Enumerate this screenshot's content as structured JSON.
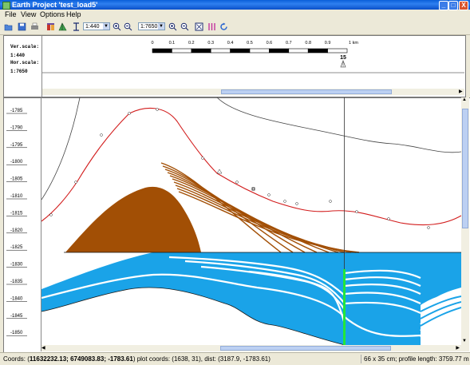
{
  "window": {
    "title": "Earth Project 'test_load5'",
    "min_label": "_",
    "max_label": "□",
    "close_label": "X"
  },
  "menu": [
    {
      "label": "File"
    },
    {
      "label": "View"
    },
    {
      "label": "Options"
    },
    {
      "label": "Help"
    }
  ],
  "toolbar": {
    "ver_zoom": "1:440",
    "hor_zoom": "1:7650"
  },
  "scale_info": {
    "ver_label": "Ver.scale:",
    "ver_value": "1:440",
    "hor_label": "Hor.scale:",
    "hor_value": "1:7650"
  },
  "ruler": {
    "ticks": [
      "0",
      "0.1",
      "0.2",
      "0.3",
      "0.4",
      "0.5",
      "0.6",
      "0.7",
      "0.8",
      "0.9",
      "1 km"
    ],
    "marker_label": "15"
  },
  "depth_axis": {
    "labels": [
      "-1785",
      "-1790",
      "-1795",
      "-1800",
      "-1805",
      "-1810",
      "-1815",
      "-1820",
      "-1825",
      "-1830",
      "-1835",
      "-1840",
      "-1845",
      "-1850"
    ]
  },
  "status": {
    "coords_prefix": "Coords: (",
    "coords_value": "11632232.13; 6749083.83; -1783.61",
    "coords_suffix": ") plot coords: (1638, 31), dist: (3187.9, -1783.61)",
    "right_text": "66 x 35 cm; profile length: 3759.77 m"
  },
  "colors": {
    "titlebar": "#0a5fd8",
    "brown": "#a24f05",
    "blue": "#1aa3e8",
    "red": "#d21c1c",
    "green": "#22e63a"
  }
}
